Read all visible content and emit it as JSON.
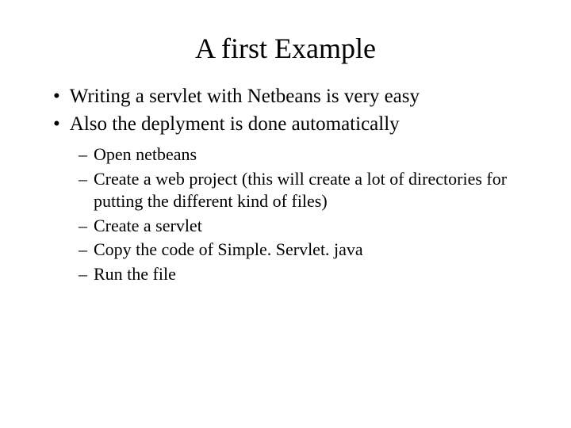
{
  "title": "A first Example",
  "bullets": [
    {
      "text": "Writing a servlet with Netbeans is very easy"
    },
    {
      "text": "Also the deplyment is done automatically"
    }
  ],
  "subbullets": [
    {
      "text": "Open netbeans"
    },
    {
      "text": "Create a web project (this will create a lot of directories for putting the different kind of files)"
    },
    {
      "text": "Create a servlet"
    },
    {
      "text": "Copy the code of Simple. Servlet. java"
    },
    {
      "text": "Run the file"
    }
  ]
}
